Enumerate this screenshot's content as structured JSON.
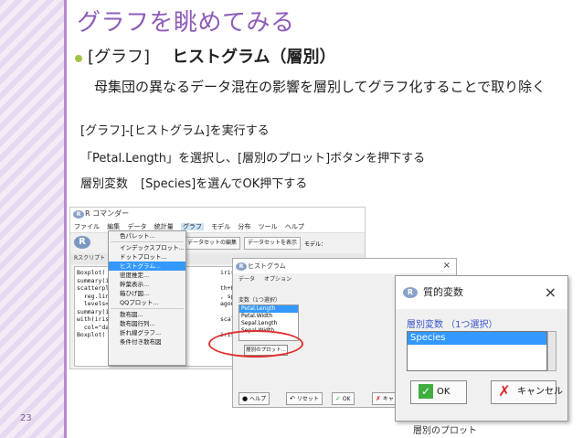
{
  "slide": {
    "title": "グラフを眺めてみる",
    "subhead_prefix": "[グラフ]",
    "subhead_bold": "ヒストグラム（層別）",
    "paragraph": "　母集団の異なるデータ混在の影響を層別してグラフ化することで取り除く",
    "step1": "[グラフ]-[ヒストグラム]を実行する",
    "step2": "「Petal.Length」を選択し、[層別のプロット]ボタンを押下する",
    "step3_a": "層別変数",
    "step3_b": "[Species]を選んでOK押下する",
    "page_number": "23",
    "accent_color": "#8e5cb8",
    "bullet_color": "#a0c44a"
  },
  "rcmd": {
    "window_title": "R コマンダー",
    "logo": "R",
    "menu": [
      "ファイル",
      "編集",
      "データ",
      "統計量",
      "グラフ",
      "モデル",
      "分布",
      "ツール",
      "ヘルプ"
    ],
    "active_menu": "グラフ",
    "toolbar": {
      "dataset_edit": "データセットの編集",
      "dataset_show": "データセットを表示",
      "model_label": "モデル："
    },
    "script_tab": "Rスクリプト",
    "script_fragments": [
      "Boxplot(",
      "summary(i",
      "scatterpl",
      "  reg.lin",
      "  levels=",
      "summary(i",
      "with(iris",
      "  col=\"da",
      "Boxplot("
    ],
    "script_right": [
      "iris, id.m",
      "",
      "th+Petal.Wi",
      ", spread=F",
      "agonal = '",
      "",
      "scale=\"fre",
      "",
      "iris, id.m"
    ]
  },
  "graph_menu": {
    "items": [
      "色パレット...",
      "インデックスプロット...",
      "ドットプロット...",
      "ヒストグラム...",
      "密度推定...",
      "幹葉表示...",
      "箱ひげ図...",
      "QQプロット...",
      "散布図...",
      "散布図行列...",
      "折れ線グラフ...",
      "条件付き散布図"
    ],
    "selected": "ヒストグラム..."
  },
  "histogram_dialog": {
    "title": "ヒストグラム",
    "tabs": [
      "データ",
      "オプション"
    ],
    "variable_label": "変数（1つ選択）",
    "variables": [
      "Petal.Length",
      "Petal.Width",
      "Sepal.Length",
      "Sepal.Width"
    ],
    "selected_variable": "Petal.Length",
    "strata_button": "層別のプロット...",
    "help": "ヘルプ",
    "reset": "リセット",
    "ok": "OK",
    "cancel": "キャ"
  },
  "qual_dialog": {
    "title": "質的変数",
    "label": "層別変数 （1つ選択）",
    "options": [
      "Species"
    ],
    "selected": "Species",
    "ok": "OK",
    "cancel": "キャンセル",
    "below_text": "層別のプロット"
  }
}
